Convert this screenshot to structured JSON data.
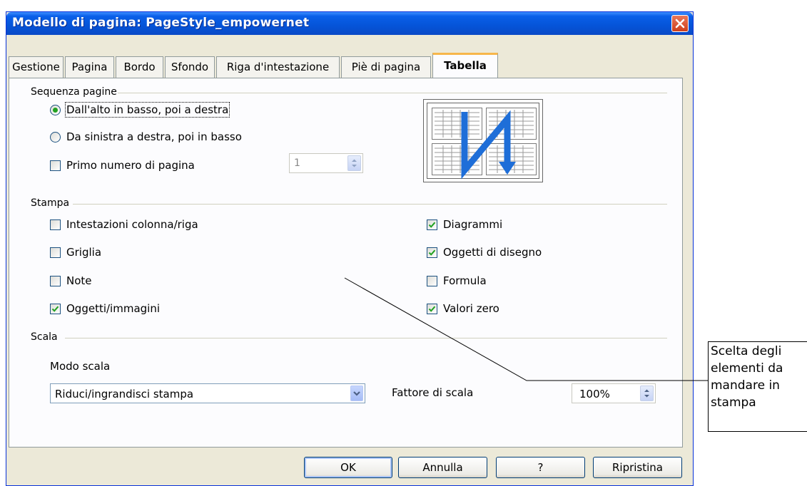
{
  "window": {
    "title": "Modello di pagina: PageStyle_empowernet"
  },
  "tabs": [
    {
      "label": "Gestione"
    },
    {
      "label": "Pagina"
    },
    {
      "label": "Bordo"
    },
    {
      "label": "Sfondo"
    },
    {
      "label": "Riga d'intestazione"
    },
    {
      "label": "Piè di pagina"
    },
    {
      "label": "Tabella",
      "active": true
    }
  ],
  "page_order": {
    "group_label": "Sequenza pagine",
    "options": [
      {
        "label": "Dall'alto in basso, poi a destra",
        "selected": true
      },
      {
        "label": "Da sinistra a destra, poi in basso",
        "selected": false
      }
    ],
    "first_page_number": {
      "label": "Primo numero di pagina",
      "checked": false,
      "value": "1"
    }
  },
  "print": {
    "group_label": "Stampa",
    "left": [
      {
        "label": "Intestazioni colonna/riga",
        "checked": false
      },
      {
        "label": "Griglia",
        "checked": false
      },
      {
        "label": "Note",
        "checked": false
      },
      {
        "label": "Oggetti/immagini",
        "checked": true
      }
    ],
    "right": [
      {
        "label": "Diagrammi",
        "checked": true
      },
      {
        "label": "Oggetti di disegno",
        "checked": true
      },
      {
        "label": "Formula",
        "checked": false
      },
      {
        "label": "Valori zero",
        "checked": true
      }
    ]
  },
  "scale": {
    "group_label": "Scala",
    "mode_label": "Modo scala",
    "mode_value": "Riduci/ingrandisci stampa",
    "factor_label": "Fattore di scala",
    "factor_value": "100%"
  },
  "buttons": {
    "ok": "OK",
    "cancel": "Annulla",
    "help": "?",
    "reset": "Ripristina"
  },
  "callout": {
    "text": "Scelta degli elementi da mandare in stampa"
  },
  "colors": {
    "titlebar": "#0554d8",
    "active_tab_accent": "#f7b64a",
    "check": "#21a121",
    "close": "#cf3f1c"
  }
}
